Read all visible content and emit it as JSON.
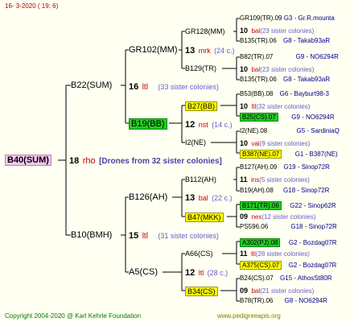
{
  "date": "16-  3-2020 ( 19:  6)",
  "root": {
    "name": "B40(SUM)",
    "num": "18",
    "type": "rho",
    "drones": "[Drones from 32 sister colonies]"
  },
  "b22": {
    "name": "B22(SUM)",
    "num": "16",
    "type": "ltl",
    "sis": "(33 sister colonies)"
  },
  "b10": {
    "name": "B10(BMH)",
    "num": "15",
    "type": "ltl",
    "sis": "(31 sister colonies)"
  },
  "gr102": {
    "name": "GR102(MM)",
    "num": "13",
    "type": "mrk",
    "sis": "(24 c.)"
  },
  "b19": {
    "name": "B19(BB)",
    "num": "12",
    "type": "nst",
    "sis": "(14 c.)"
  },
  "b126": {
    "name": "B126(AH)",
    "num": "13",
    "type": "bal",
    "sis": "(22 c.)"
  },
  "a5": {
    "name": "A5(CS)",
    "num": "12",
    "type": "ltl",
    "sis": "(28 c.)"
  },
  "gr128": "GR128(MM)",
  "b129": "B129(TR)",
  "b27": "B27(BB)",
  "i2": "I2(NE)",
  "b112": "B112(AH)",
  "b47": "B47(MKK)",
  "a66": "A66(CS)",
  "b34": "B34(CS)",
  "right": [
    {
      "name": "GR109(TR).09",
      "info": "G3 - Gr.R.mounta"
    },
    {
      "num": "10",
      "type": "bal",
      "sis": "(23 sister colonies)"
    },
    {
      "name": "B135(TR).06",
      "info": "G8 - Takab93aR"
    },
    {
      "name": "B82(TR).07",
      "info": "G9 - NO6294R"
    },
    {
      "num": "10",
      "type": "bal",
      "sis": "(23 sister colonies)"
    },
    {
      "name": "B135(TR).06",
      "info": "G8 - Takab93aR"
    },
    {
      "name": "B53(BB).08",
      "info": "G6 - Bayburt98-3"
    },
    {
      "num": "10",
      "type": "ltl",
      "sis": "(32 sister colonies)"
    },
    {
      "name": "B25(CS).07",
      "info": "G9 - NO6294R"
    },
    {
      "name": "I2(NE).08",
      "info": "G5 - SardiniaQ"
    },
    {
      "num": "10",
      "type": "val",
      "sis": "(9 sister colonies)"
    },
    {
      "name": "B387(NE).07",
      "info": "G1 - B387(NE)"
    },
    {
      "name": "B127(AH).09",
      "info": "G19 - Sinop72R"
    },
    {
      "num": "11",
      "type": "ins",
      "sis": "(5 sister colonies)"
    },
    {
      "name": "B19(AH).08",
      "info": "G18 - Sinop72R"
    },
    {
      "name": "B171(TR).06",
      "info": "G22 - Sinop62R"
    },
    {
      "num": "09",
      "type": "nex",
      "sis": "(12 sister colonies)"
    },
    {
      "name": "PS596.06",
      "info": "G18 - Sinop72R"
    },
    {
      "name": "A302(PJ).08",
      "info": "G2 - Bozdag07R"
    },
    {
      "num": "11",
      "type": "ltl",
      "sis": "(28 sister colonies)"
    },
    {
      "name": "A375(CS).07",
      "info": "G2 - Bozdag07R"
    },
    {
      "name": "B24(CS).07",
      "info": "G15 - AthosSt80R"
    },
    {
      "num": "09",
      "type": "bal",
      "sis": "(21 sister colonies)"
    },
    {
      "name": "B78(TR).06",
      "info": "G8 - NO6294R"
    }
  ],
  "footer": "Copyright 2004-2020 @ Karl Kehrle Foundation",
  "footer_site": "www.pedigreeapis.org"
}
